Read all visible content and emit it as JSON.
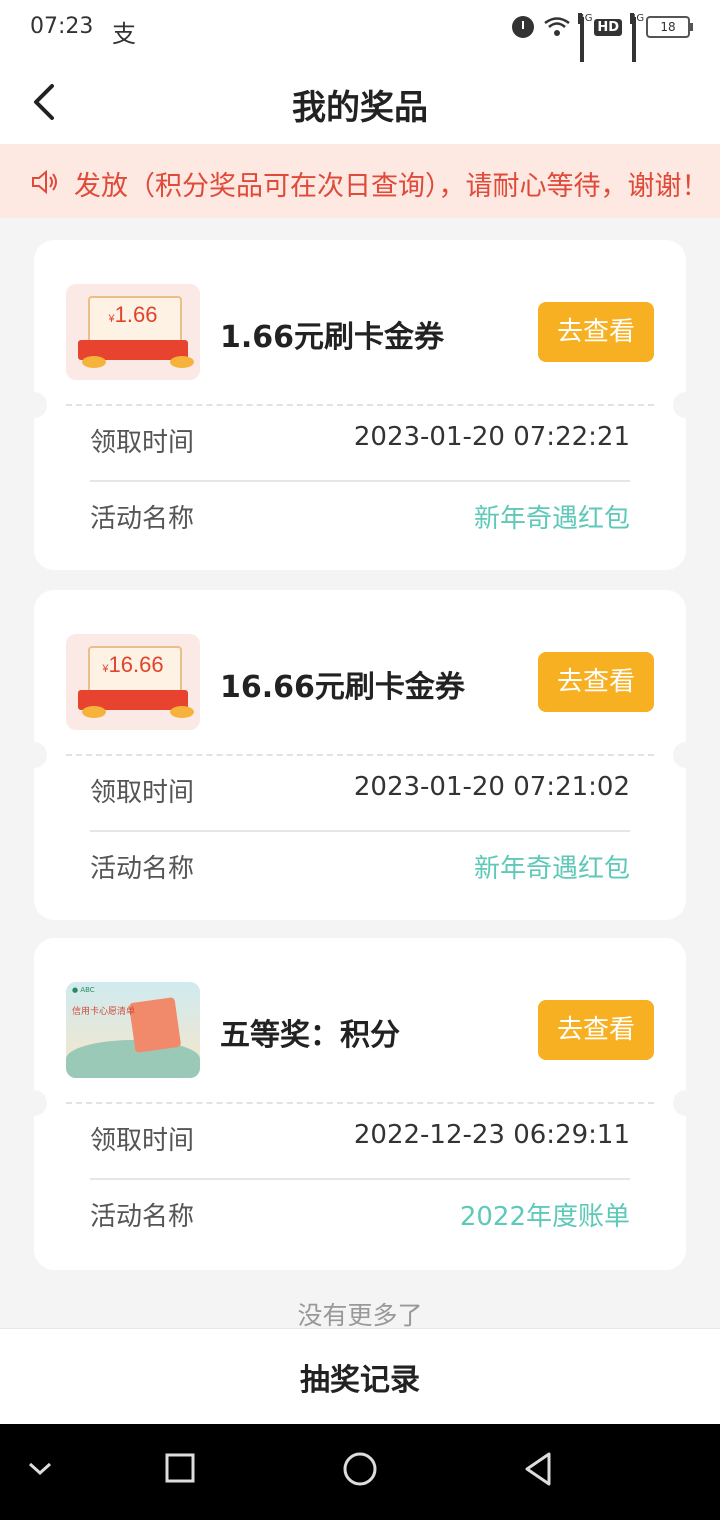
{
  "status_bar": {
    "time": "07:23",
    "app_glyph": "支",
    "network_1": "4G",
    "hd": "HD",
    "network_2": "4G",
    "battery": "18"
  },
  "header": {
    "title": "我的奖品"
  },
  "notice": {
    "text": "发放（积分奖品可在次日查询），请耐心等待，谢谢！",
    "color": "#e04a38"
  },
  "prizes": [
    {
      "thumb_value": "1.66",
      "name": "1.66元刷卡金券",
      "view_label": "去查看",
      "time_label": "领取时间",
      "time_value": "2023-01-20 07:22:21",
      "activity_label": "活动名称",
      "activity_value": "新年奇遇红包"
    },
    {
      "thumb_value": "16.66",
      "name": "16.66元刷卡金券",
      "view_label": "去查看",
      "time_label": "领取时间",
      "time_value": "2023-01-20 07:21:02",
      "activity_label": "活动名称",
      "activity_value": "新年奇遇红包"
    },
    {
      "thumb_text": "信用卡心愿清单",
      "name": "五等奖：积分",
      "view_label": "去查看",
      "time_label": "领取时间",
      "time_value": "2022-12-23 06:29:11",
      "activity_label": "活动名称",
      "activity_value": "2022年度账单"
    }
  ],
  "footer_note": "没有更多了",
  "bottom_action": "抽奖记录",
  "colors": {
    "accent_button": "#f7b021",
    "activity_link": "#5ec9b8",
    "notice_bg": "#fde8e2"
  }
}
